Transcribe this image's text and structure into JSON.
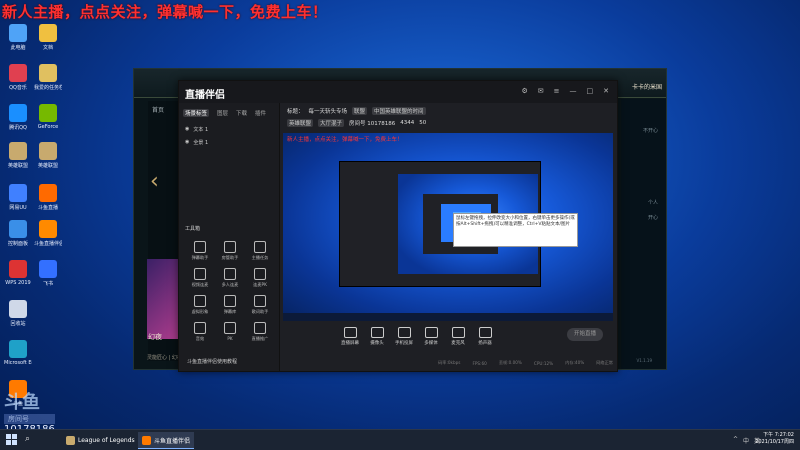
{
  "banner": "新人主播，点点关注，弹幕喊一下，免费上车！",
  "desktop_icons": [
    {
      "label": "此电脑",
      "color": "#4fa3f7",
      "icon": "computer-icon"
    },
    {
      "label": "文档",
      "color": "#f0c040",
      "icon": "folder-icon"
    },
    {
      "label": "QQ音乐",
      "color": "#e04050",
      "icon": "qqmusic-icon"
    },
    {
      "label": "我爱的任务栏",
      "color": "#e0c060",
      "icon": "folder-icon"
    },
    {
      "label": "腾讯QQ",
      "color": "#1a8fff",
      "icon": "qq-icon"
    },
    {
      "label": "GeForce",
      "color": "#76b900",
      "icon": "geforce-icon"
    },
    {
      "label": "英雄联盟",
      "color": "#c8aa6e",
      "icon": "lol-icon"
    },
    {
      "label": "英雄联盟",
      "color": "#c8aa6e",
      "icon": "lol-icon"
    },
    {
      "label": "网易UU",
      "color": "#4080ff",
      "icon": "uu-icon"
    },
    {
      "label": "斗鱼直播",
      "color": "#ff6a00",
      "icon": "douyu-icon"
    },
    {
      "label": "控制面板",
      "color": "#3a8fe8",
      "icon": "control-panel-icon"
    },
    {
      "label": "斗鱼直播伴侣",
      "color": "#ff8a00",
      "icon": "douyu-icon"
    },
    {
      "label": "WPS 2019",
      "color": "#d33",
      "icon": "wps-icon"
    },
    {
      "label": "飞书",
      "color": "#3370ff",
      "icon": "feishu-icon"
    },
    {
      "label": "回收站",
      "color": "#cfd8e8",
      "icon": "recycle-bin-icon"
    },
    {
      "label": "Microsoft Edge",
      "color": "#1fa1c8",
      "icon": "edge-icon"
    },
    {
      "label": "斗鱼",
      "color": "#ff7a00",
      "icon": "douyu-icon"
    }
  ],
  "lol": {
    "tab_home": "首页",
    "user_name": "卡卡的米国",
    "card_title": "幻夜",
    "card_sub": "灵能匠心 | 幻夜",
    "right_texts": [
      "不开心",
      "个人",
      "开心"
    ],
    "bottom_num": "V1.1.19"
  },
  "zb": {
    "logo": "直播伴侣",
    "tabs": [
      "场景标签",
      "图层",
      "下载",
      "插件"
    ],
    "scenes": [
      "文本 1",
      "全景 1"
    ],
    "tools_title": "工具箱",
    "tools": [
      {
        "label": "弹幕助手"
      },
      {
        "label": "房管助手"
      },
      {
        "label": "主播任务"
      },
      {
        "label": "视频连麦"
      },
      {
        "label": "多人连麦"
      },
      {
        "label": "连麦PK"
      },
      {
        "label": "虚拟形象"
      },
      {
        "label": "弹幕库"
      },
      {
        "label": "歌词助手"
      },
      {
        "label": "音效"
      },
      {
        "label": "PK"
      },
      {
        "label": "直播推广"
      }
    ],
    "bottom_ad": "斗鱼直播伴侣使用教程",
    "head": {
      "title_prefix": "标题：",
      "title": "每一天斩头专场",
      "tag1": "联盟",
      "tag2": "中国英雄联盟的时间",
      "category": "英雄联盟",
      "sub_tag": "大厅混子",
      "room_id": "房间号 10178186",
      "hot": "4344",
      "fans": "50"
    },
    "preview_red": "新人主播，点点关注，弹幕喊一下，免费上车！",
    "tooltip": "鼠标左键拖拽，拉伸改变大小和位置，右键单击更多操作(或按Alt+Shift+拖拽)可以精准调整，Ctrl+V粘贴文本/图片",
    "controls": [
      {
        "label": "直播屏幕",
        "icon": "screen-icon"
      },
      {
        "label": "摄像头",
        "icon": "camera-icon"
      },
      {
        "label": "手机投屏",
        "icon": "phone-cast-icon"
      },
      {
        "label": "多媒体",
        "icon": "media-icon"
      },
      {
        "label": "麦克风",
        "icon": "mic-icon"
      },
      {
        "label": "扬声器",
        "icon": "speaker-icon"
      }
    ],
    "start_live": "开始直播",
    "status": [
      "码率:0kbps",
      "FPS:60",
      "丢帧:0.00%",
      "CPU:12%",
      "内存:40%",
      "网络正常"
    ]
  },
  "watermark": {
    "logo": "斗鱼",
    "sub": "房间号",
    "num": "10178186"
  },
  "taskbar": {
    "apps": [
      {
        "label": "League of Legends",
        "color": "#c8aa6e",
        "active": false
      },
      {
        "label": "斗鱼直播伴侣",
        "color": "#ff7a00",
        "active": true
      }
    ],
    "tray": [
      "^",
      "中",
      "英"
    ],
    "time": "下午 7:27:02",
    "date": "2021/10/17周四"
  }
}
